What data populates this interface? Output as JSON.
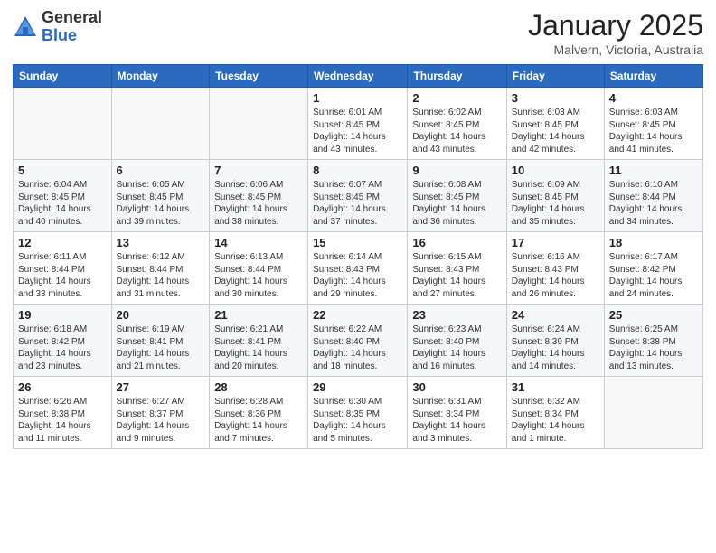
{
  "header": {
    "logo_general": "General",
    "logo_blue": "Blue",
    "title": "January 2025",
    "location": "Malvern, Victoria, Australia"
  },
  "weekdays": [
    "Sunday",
    "Monday",
    "Tuesday",
    "Wednesday",
    "Thursday",
    "Friday",
    "Saturday"
  ],
  "weeks": [
    [
      {
        "day": "",
        "info": ""
      },
      {
        "day": "",
        "info": ""
      },
      {
        "day": "",
        "info": ""
      },
      {
        "day": "1",
        "info": "Sunrise: 6:01 AM\nSunset: 8:45 PM\nDaylight: 14 hours\nand 43 minutes."
      },
      {
        "day": "2",
        "info": "Sunrise: 6:02 AM\nSunset: 8:45 PM\nDaylight: 14 hours\nand 43 minutes."
      },
      {
        "day": "3",
        "info": "Sunrise: 6:03 AM\nSunset: 8:45 PM\nDaylight: 14 hours\nand 42 minutes."
      },
      {
        "day": "4",
        "info": "Sunrise: 6:03 AM\nSunset: 8:45 PM\nDaylight: 14 hours\nand 41 minutes."
      }
    ],
    [
      {
        "day": "5",
        "info": "Sunrise: 6:04 AM\nSunset: 8:45 PM\nDaylight: 14 hours\nand 40 minutes."
      },
      {
        "day": "6",
        "info": "Sunrise: 6:05 AM\nSunset: 8:45 PM\nDaylight: 14 hours\nand 39 minutes."
      },
      {
        "day": "7",
        "info": "Sunrise: 6:06 AM\nSunset: 8:45 PM\nDaylight: 14 hours\nand 38 minutes."
      },
      {
        "day": "8",
        "info": "Sunrise: 6:07 AM\nSunset: 8:45 PM\nDaylight: 14 hours\nand 37 minutes."
      },
      {
        "day": "9",
        "info": "Sunrise: 6:08 AM\nSunset: 8:45 PM\nDaylight: 14 hours\nand 36 minutes."
      },
      {
        "day": "10",
        "info": "Sunrise: 6:09 AM\nSunset: 8:45 PM\nDaylight: 14 hours\nand 35 minutes."
      },
      {
        "day": "11",
        "info": "Sunrise: 6:10 AM\nSunset: 8:44 PM\nDaylight: 14 hours\nand 34 minutes."
      }
    ],
    [
      {
        "day": "12",
        "info": "Sunrise: 6:11 AM\nSunset: 8:44 PM\nDaylight: 14 hours\nand 33 minutes."
      },
      {
        "day": "13",
        "info": "Sunrise: 6:12 AM\nSunset: 8:44 PM\nDaylight: 14 hours\nand 31 minutes."
      },
      {
        "day": "14",
        "info": "Sunrise: 6:13 AM\nSunset: 8:44 PM\nDaylight: 14 hours\nand 30 minutes."
      },
      {
        "day": "15",
        "info": "Sunrise: 6:14 AM\nSunset: 8:43 PM\nDaylight: 14 hours\nand 29 minutes."
      },
      {
        "day": "16",
        "info": "Sunrise: 6:15 AM\nSunset: 8:43 PM\nDaylight: 14 hours\nand 27 minutes."
      },
      {
        "day": "17",
        "info": "Sunrise: 6:16 AM\nSunset: 8:43 PM\nDaylight: 14 hours\nand 26 minutes."
      },
      {
        "day": "18",
        "info": "Sunrise: 6:17 AM\nSunset: 8:42 PM\nDaylight: 14 hours\nand 24 minutes."
      }
    ],
    [
      {
        "day": "19",
        "info": "Sunrise: 6:18 AM\nSunset: 8:42 PM\nDaylight: 14 hours\nand 23 minutes."
      },
      {
        "day": "20",
        "info": "Sunrise: 6:19 AM\nSunset: 8:41 PM\nDaylight: 14 hours\nand 21 minutes."
      },
      {
        "day": "21",
        "info": "Sunrise: 6:21 AM\nSunset: 8:41 PM\nDaylight: 14 hours\nand 20 minutes."
      },
      {
        "day": "22",
        "info": "Sunrise: 6:22 AM\nSunset: 8:40 PM\nDaylight: 14 hours\nand 18 minutes."
      },
      {
        "day": "23",
        "info": "Sunrise: 6:23 AM\nSunset: 8:40 PM\nDaylight: 14 hours\nand 16 minutes."
      },
      {
        "day": "24",
        "info": "Sunrise: 6:24 AM\nSunset: 8:39 PM\nDaylight: 14 hours\nand 14 minutes."
      },
      {
        "day": "25",
        "info": "Sunrise: 6:25 AM\nSunset: 8:38 PM\nDaylight: 14 hours\nand 13 minutes."
      }
    ],
    [
      {
        "day": "26",
        "info": "Sunrise: 6:26 AM\nSunset: 8:38 PM\nDaylight: 14 hours\nand 11 minutes."
      },
      {
        "day": "27",
        "info": "Sunrise: 6:27 AM\nSunset: 8:37 PM\nDaylight: 14 hours\nand 9 minutes."
      },
      {
        "day": "28",
        "info": "Sunrise: 6:28 AM\nSunset: 8:36 PM\nDaylight: 14 hours\nand 7 minutes."
      },
      {
        "day": "29",
        "info": "Sunrise: 6:30 AM\nSunset: 8:35 PM\nDaylight: 14 hours\nand 5 minutes."
      },
      {
        "day": "30",
        "info": "Sunrise: 6:31 AM\nSunset: 8:34 PM\nDaylight: 14 hours\nand 3 minutes."
      },
      {
        "day": "31",
        "info": "Sunrise: 6:32 AM\nSunset: 8:34 PM\nDaylight: 14 hours\nand 1 minute."
      },
      {
        "day": "",
        "info": ""
      }
    ]
  ]
}
